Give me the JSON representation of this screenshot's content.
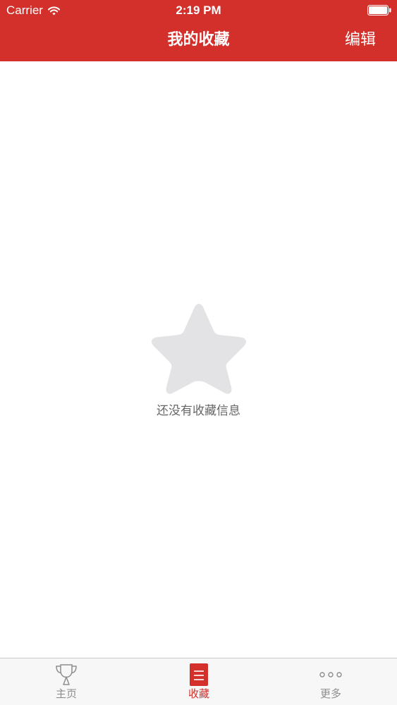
{
  "colors": {
    "accent": "#d3302c",
    "tab_inactive": "#8e8e8e",
    "empty_icon": "#e3e3e6",
    "empty_text": "#666666"
  },
  "status_bar": {
    "carrier": "Carrier",
    "time": "2:19 PM",
    "wifi_icon": "wifi-icon",
    "battery_icon": "battery-icon"
  },
  "nav": {
    "title": "我的收藏",
    "edit_label": "编辑"
  },
  "empty_state": {
    "icon": "star-icon",
    "message": "还没有收藏信息"
  },
  "tabs": [
    {
      "label": "主页",
      "icon": "trophy-icon",
      "selected": false
    },
    {
      "label": "收藏",
      "icon": "list-icon",
      "selected": true
    },
    {
      "label": "更多",
      "icon": "more-dots-icon",
      "selected": false
    }
  ]
}
